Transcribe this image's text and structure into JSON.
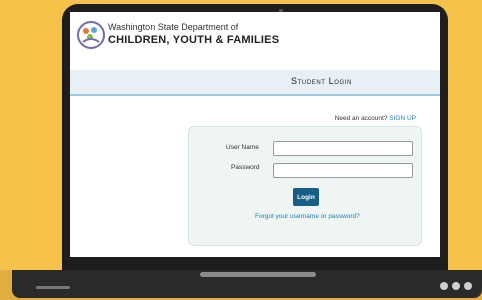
{
  "header": {
    "org_line_1": "Washington State Department of",
    "org_line_2": "CHILDREN, YOUTH & FAMILIES"
  },
  "page": {
    "title": "Student Login"
  },
  "signup": {
    "prompt": "Need an account?",
    "link_label": "SIGN UP"
  },
  "login_form": {
    "username_label": "User Name",
    "password_label": "Password",
    "username_value": "",
    "password_value": "",
    "login_button": "Login",
    "forgot_link": "Forgot your username or password?"
  },
  "colors": {
    "background": "#f6c24a",
    "accent_blue": "#155f86",
    "link_blue": "#1f7db6",
    "title_bar": "#e6f0f5"
  }
}
